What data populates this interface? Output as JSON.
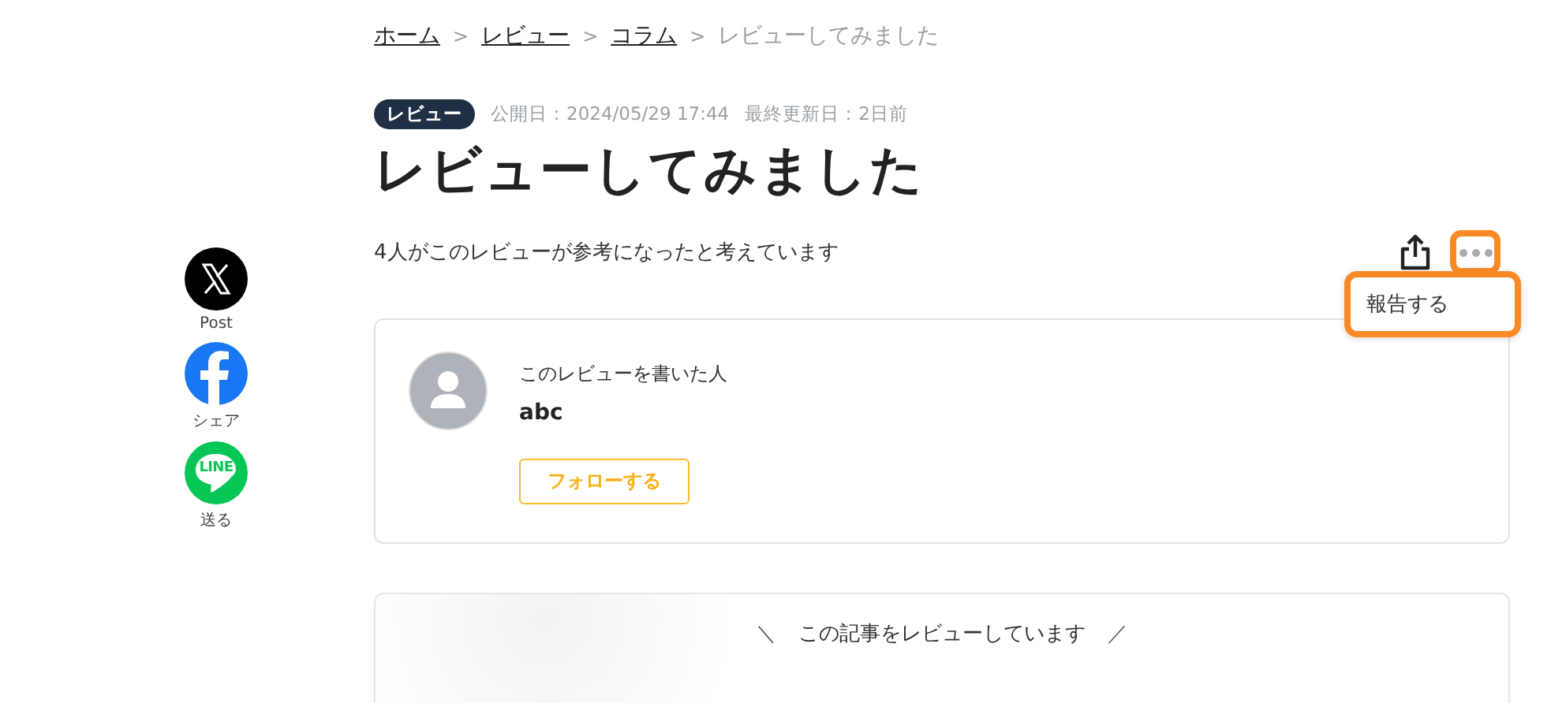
{
  "breadcrumb": [
    {
      "label": "ホーム",
      "kind": "link"
    },
    {
      "label": "レビュー",
      "kind": "link"
    },
    {
      "label": "コラム",
      "kind": "link"
    },
    {
      "label": "レビューしてみました",
      "kind": "current"
    }
  ],
  "breadcrumb_separator": ">",
  "share": [
    {
      "kind": "x",
      "label": "Post"
    },
    {
      "kind": "facebook",
      "label": "シェア"
    },
    {
      "kind": "line",
      "label": "送る",
      "logo_text": "LINE"
    }
  ],
  "article": {
    "tag": "レビュー",
    "published": "公開日：2024/05/29 17:44",
    "updated": "最終更新日：2日前",
    "title": "レビューしてみました",
    "helpful": "4人がこのレビューが参考になったと考えています"
  },
  "more_menu": {
    "expanded": true,
    "highlighted": true,
    "items": [
      {
        "label": "報告する"
      }
    ]
  },
  "author_card": {
    "heading": "このレビューを書いた人",
    "name": "abc",
    "follow_button": "フォローする"
  },
  "reviewed_card": {
    "heading": "この記事をレビューしています",
    "left_mark": "＼",
    "right_mark": "／"
  }
}
